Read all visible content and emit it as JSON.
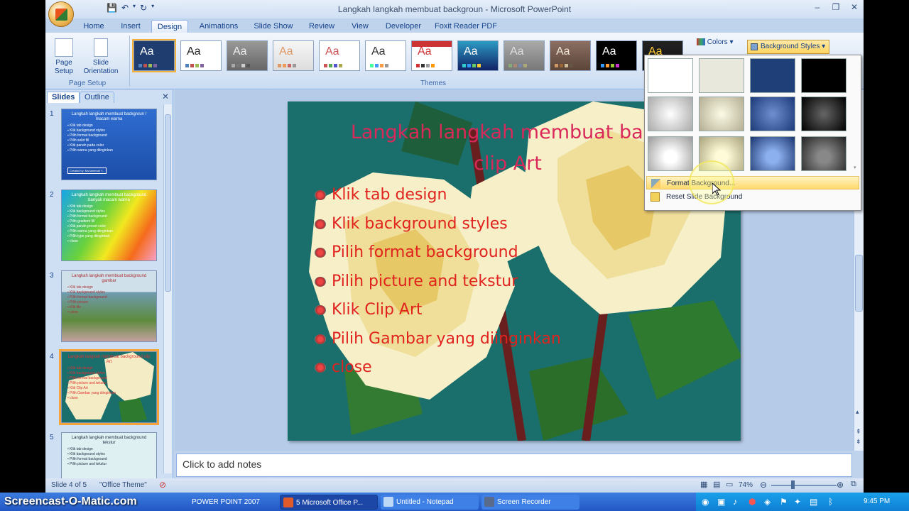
{
  "app": {
    "title": "Langkah langkah membuat backgroun - Microsoft PowerPoint"
  },
  "ribbon": {
    "tabs": [
      "Home",
      "Insert",
      "Design",
      "Animations",
      "Slide Show",
      "Review",
      "View",
      "Developer",
      "Foxit Reader PDF"
    ],
    "active_tab": "Design",
    "page_setup": {
      "page_setup_label": "Page Setup",
      "orientation_label": "Slide Orientation",
      "group_label": "Page Setup"
    },
    "themes_group_label": "Themes",
    "colors_label": "Colors",
    "background_styles_label": "Background Styles",
    "theme_sample": "Aa"
  },
  "slides_pane": {
    "tabs": [
      "Slides",
      "Outline"
    ],
    "slides": [
      {
        "num": "1",
        "title": "Langkah langkah membuat backgroun / macam warna",
        "items": [
          "Klik tab design",
          "Klik background styles",
          "Pilih format background",
          "Pilih solid fill",
          "Klik panah pada color",
          "Pilih warna yang diinginkan"
        ],
        "footer": "Created by: Muhammad Y..."
      },
      {
        "num": "2",
        "title": "Langkah langkah membuat background banyak macam warna",
        "items": [
          "Klik tab design",
          "Klik background styles",
          "Pilih format background",
          "Pilih gradient fill",
          "Klik panah preset color",
          "Pilih warna yang diinginkan",
          "Pilih type yang diinginkan",
          "close"
        ]
      },
      {
        "num": "3",
        "title": "Langkah langkah membuat background gambar",
        "items": [
          "Klik tab design",
          "Klik background styles",
          "Pilih format background",
          "Pilih picture",
          "Klik file",
          "close"
        ]
      },
      {
        "num": "4",
        "title": "Langkah langkah membuat background clip Art",
        "items": [
          "Klik tab design",
          "Klik background styles",
          "Pilih format background",
          "Pilih picture and tekstur",
          "Klik Clip Art",
          "Pilih Gambar yang diinginkan",
          "close"
        ]
      },
      {
        "num": "5",
        "title": "Langkah langkah membuat background tekstur",
        "items": [
          "Klik tab design",
          "Klik background styles",
          "Pilih format background",
          "Pilih picture and tekstur"
        ]
      }
    ]
  },
  "slide": {
    "title_line1": "Langkah langkah membuat  back",
    "title_line2": "clip Art",
    "bullets": [
      "Klik tab design",
      "Klik background styles",
      "Pilih format background",
      "Pilih picture and tekstur",
      "Klik Clip Art",
      "Pilih Gambar yang diinginkan",
      "close"
    ]
  },
  "notes": {
    "placeholder": "Click to add notes"
  },
  "statusbar": {
    "slide_info": "Slide 4 of 5",
    "theme": "\"Office Theme\"",
    "zoom": "74%"
  },
  "dropdown": {
    "menu": [
      "Format Background...",
      "Reset Slide Background"
    ]
  },
  "taskbar": {
    "watermark": "Screencast-O-Matic.com",
    "items": [
      "POWER POINT 2007",
      "5 Microsoft Office P...",
      "Untitled - Notepad",
      "Screen Recorder"
    ],
    "clock": "9:45 PM"
  },
  "colors": {
    "slide_bg": "#1a6f6c",
    "title": "#d8295a",
    "bullet_text": "#e0231e",
    "highlight": "#ffd461"
  }
}
